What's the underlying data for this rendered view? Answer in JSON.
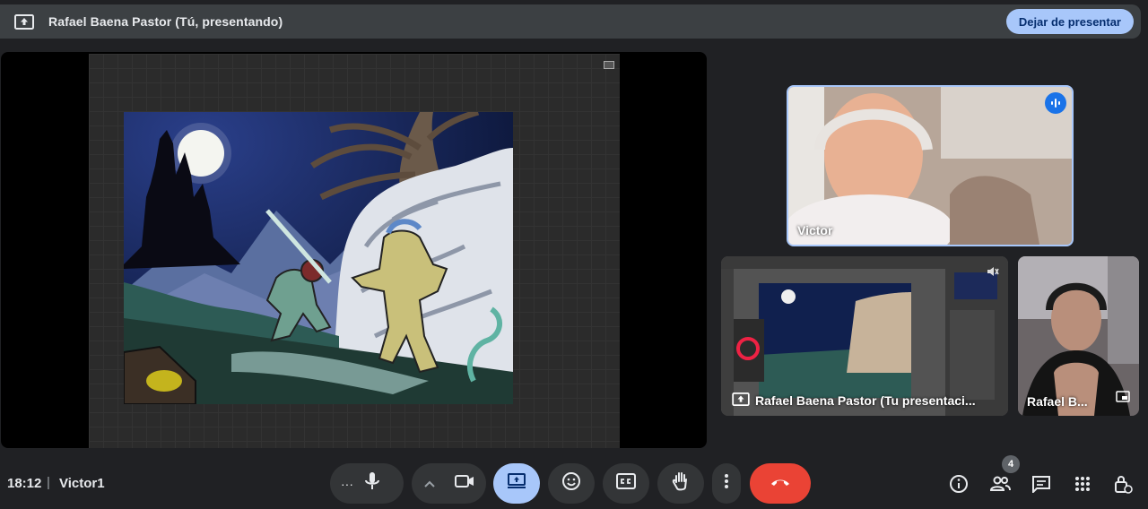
{
  "topbar": {
    "title": "Rafael Baena Pastor (Tú, presentando)",
    "stop_label": "Dejar de presentar"
  },
  "tiles": {
    "victor_label": "Victor",
    "screen_label": "Rafael Baena Pastor (Tu presentaci...",
    "rafael_label": "Rafael B..."
  },
  "bottombar": {
    "time": "18:12",
    "separator": "|",
    "meeting_name": "Victor1",
    "more_label": "···",
    "participants_count": "4"
  },
  "colors": {
    "accent": "#a8c7fa",
    "end_call": "#ea4335",
    "surface": "#202124"
  },
  "icons": [
    "present-icon",
    "mic-icon",
    "chevron-up-icon",
    "camera-icon",
    "present-screen-icon",
    "emoji-icon",
    "captions-icon",
    "raise-hand-icon",
    "more-vert-icon",
    "end-call-icon",
    "info-icon",
    "people-icon",
    "chat-icon",
    "apps-icon",
    "host-controls-icon",
    "speaking-icon",
    "pin-icon",
    "tile-present-icon"
  ]
}
